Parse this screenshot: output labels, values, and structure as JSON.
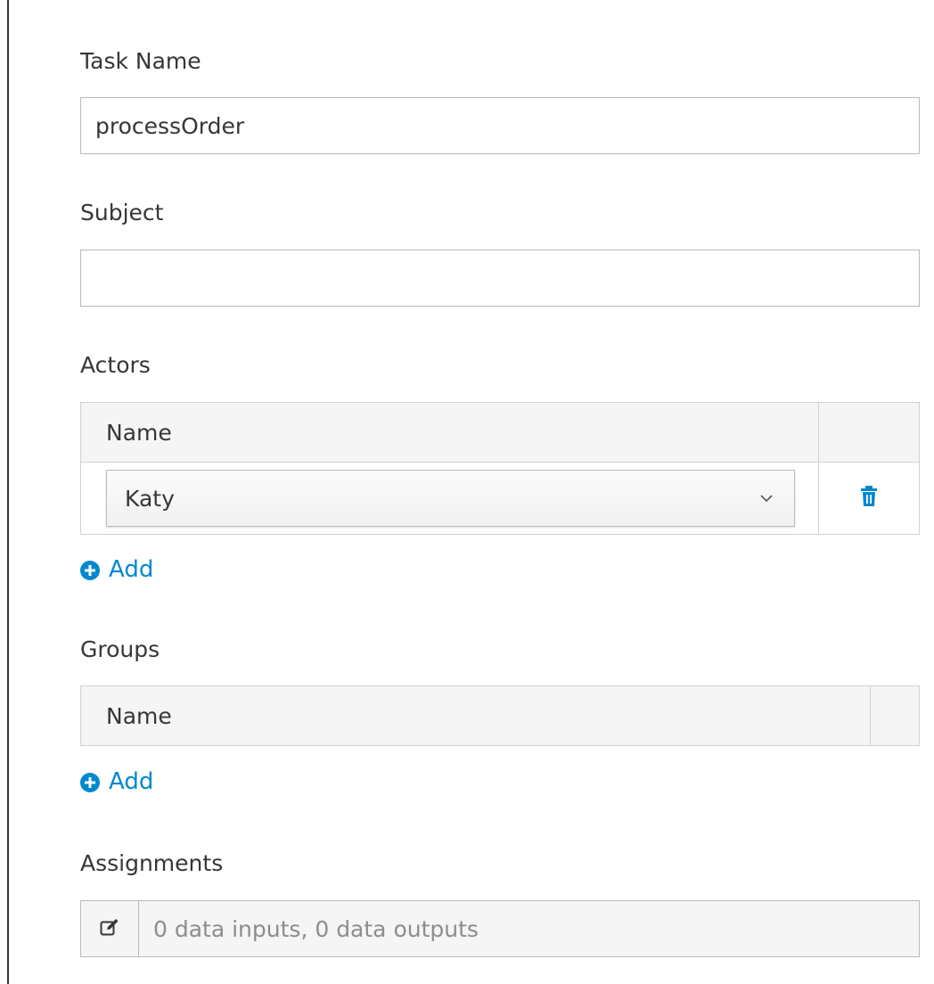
{
  "task_name": {
    "label": "Task Name",
    "value": "processOrder"
  },
  "subject": {
    "label": "Subject",
    "value": ""
  },
  "actors": {
    "label": "Actors",
    "column_header": "Name",
    "rows": [
      {
        "name": "Katy"
      }
    ],
    "add_label": "Add"
  },
  "groups": {
    "label": "Groups",
    "column_header": "Name",
    "rows": [],
    "add_label": "Add"
  },
  "assignments": {
    "label": "Assignments",
    "summary": "0 data inputs, 0 data outputs"
  },
  "colors": {
    "link": "#0088ce",
    "header_bg": "#f5f5f5",
    "border": "#bbbbbb",
    "text": "#363636",
    "muted_text": "#8b8d8f"
  },
  "icons": {
    "delete": "trash-icon",
    "add": "plus-circle-icon",
    "dropdown": "chevron-down-icon",
    "edit": "edit-icon"
  }
}
